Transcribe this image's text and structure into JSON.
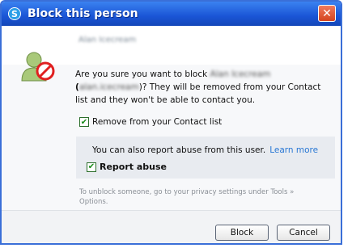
{
  "window": {
    "title": "Block this person",
    "close_label": "✕",
    "app_icon_label": "S"
  },
  "contact": {
    "name": "Alan Icecream"
  },
  "message": {
    "part1": "Are you sure you want to block ",
    "name": "Alan Icecream",
    "part2": "(",
    "email": "alan.icecream",
    "part3": ")? They will be removed from your Contact list and they won't be able to contact you."
  },
  "remove_option": {
    "label": "Remove from your Contact list",
    "checked": true
  },
  "report": {
    "text": "You can also report abuse from this user.",
    "link": "Learn more",
    "checkbox_label": "Report abuse",
    "checked": true
  },
  "footer_note": "To unblock someone, go to your privacy settings under Tools » Options.",
  "buttons": {
    "block": "Block",
    "cancel": "Cancel"
  },
  "colors": {
    "title_bar": "#1a55d6",
    "link": "#2a78d4",
    "close": "#d4441e",
    "block_badge": "#e02020"
  }
}
